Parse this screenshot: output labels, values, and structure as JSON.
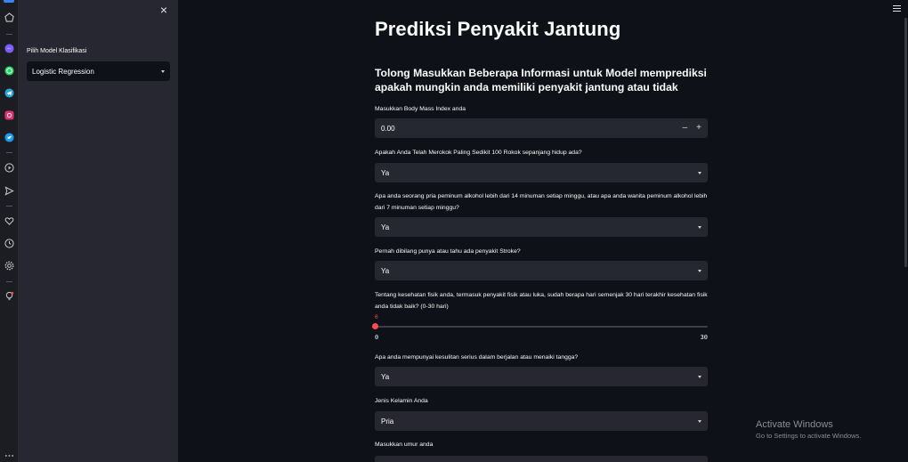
{
  "rail": {
    "icons": [
      "home-icon",
      "messenger-icon",
      "whatsapp-icon",
      "telegram-icon",
      "instagram-icon",
      "twitter-icon",
      "play-circle-icon",
      "send-icon",
      "heart-icon",
      "history-icon",
      "settings-icon",
      "lightbulb-icon",
      "more-icon"
    ],
    "accent": "#3b82f6"
  },
  "sidebar": {
    "close_glyph": "×",
    "model_label": "Pilih Model Klasifikasi",
    "model_value": "Logistic Regression"
  },
  "main": {
    "title": "Prediksi Penyakit Jantung",
    "subtitle": "Tolong Masukkan Beberapa Informasi untuk Model memprediksi apakah mungkin anda memiliki penyakit jantung atau tidak",
    "bmi": {
      "label": "Masukkan Body Mass Index anda",
      "value": "0.00",
      "minus": "–",
      "plus": "+"
    },
    "smoking": {
      "label": "Apakah Anda Telah Merokok Paling Sedikit 100 Rokok sepanjang hidup ada?",
      "value": "Ya"
    },
    "alcohol": {
      "label": "Apa anda seorang pria peminum alkohol lebih dari 14 minuman setiap minggu, atau apa anda wanita peminum alkohol lebih dari 7 minuman setiap minggu?",
      "value": "Ya"
    },
    "stroke": {
      "label": "Pernah dibilang punya atau tahu ada penyakit Stroke?",
      "value": "Ya"
    },
    "physical_health": {
      "label": "Tentang kesehatan fisik anda, termasuk penyakit fisik atau luka, sudah berapa hari semenjak 30 hari terakhir kesehatan fisik anda tidak baik? (0-30 hari)",
      "current": "0",
      "min": "0",
      "max": "30",
      "level": 0,
      "accent": "#ff4b4b"
    },
    "walking": {
      "label": "Apa anda mempunyai kesulitan serius dalam berjalan atau menaiki tangga?",
      "value": "Ya"
    },
    "sex": {
      "label": "Jenis Kelamin Anda",
      "value": "Pria"
    },
    "age": {
      "label": "Masukkan umur anda"
    }
  },
  "watermark": {
    "line1": "Activate Windows",
    "line2": "Go to Settings to activate Windows."
  }
}
